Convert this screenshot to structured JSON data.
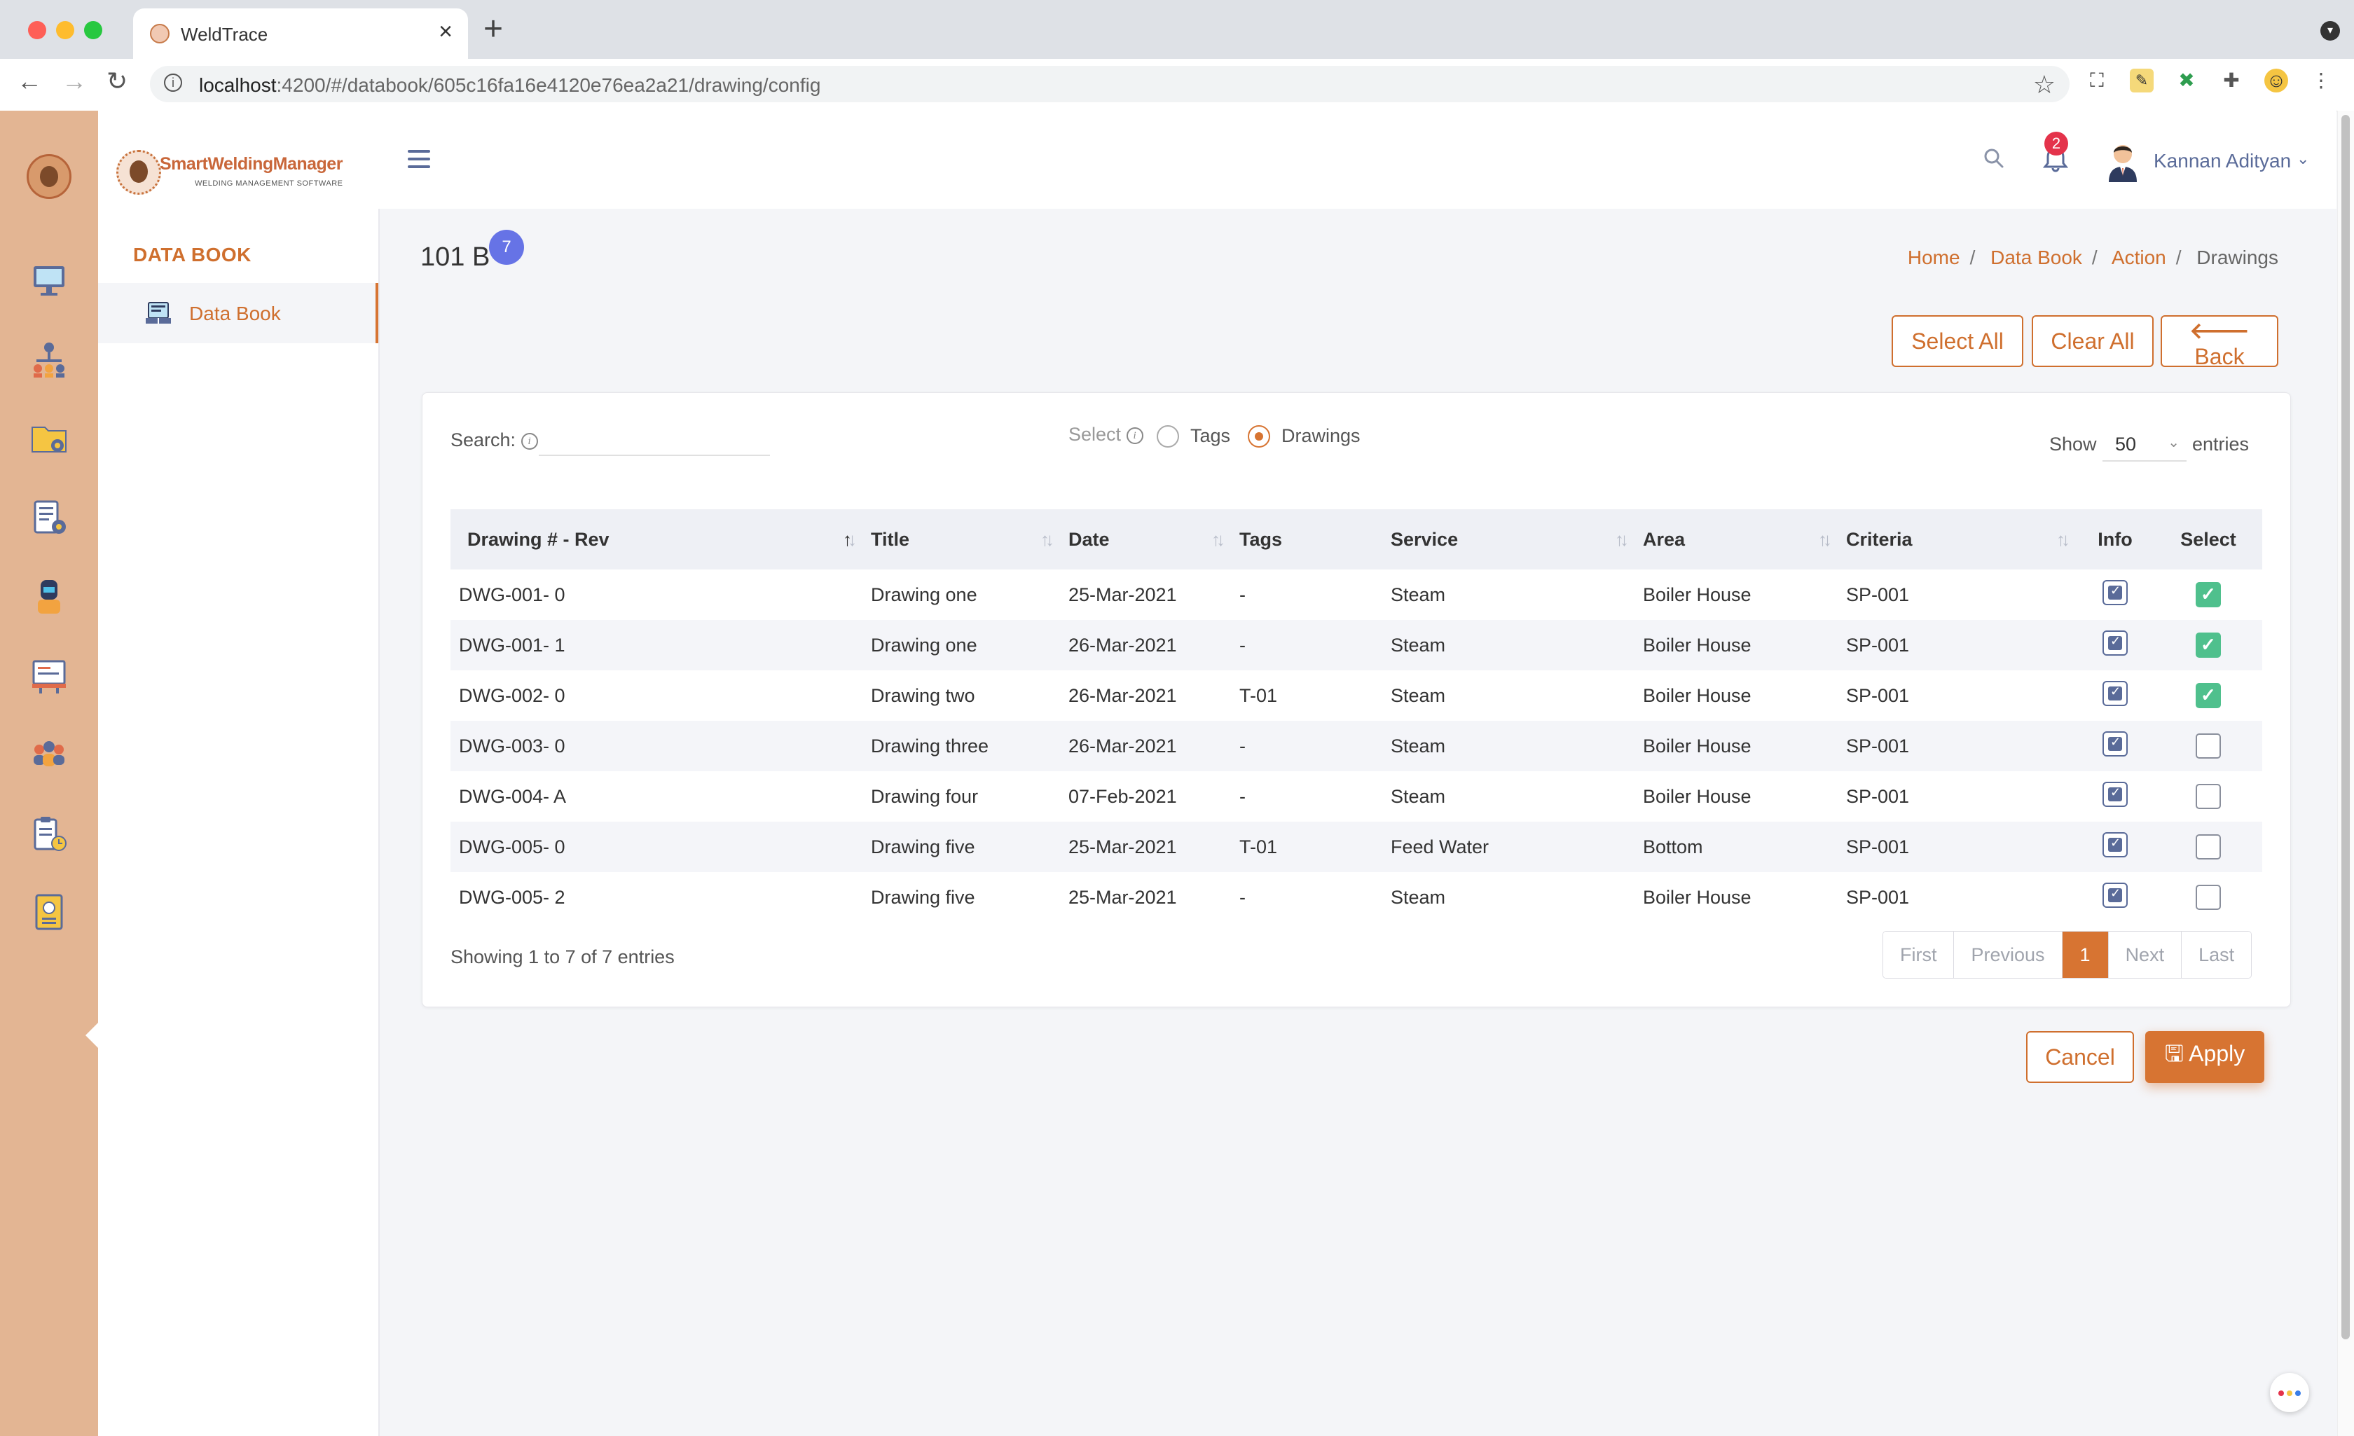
{
  "browser": {
    "tab_title": "WeldTrace",
    "url_host": "localhost",
    "url_path": ":4200/#/databook/605c16fa16e4120e76ea2a21/drawing/config"
  },
  "brand": {
    "name": "SmartWeldingManager",
    "tagline": "WELDING MANAGEMENT SOFTWARE",
    "accent": "#d77432"
  },
  "nav": {
    "section": "DATA BOOK",
    "items": [
      {
        "label": "Data Book"
      }
    ]
  },
  "header": {
    "notification_count": "2",
    "user_name": "Kannan Adityan"
  },
  "page": {
    "title": "101 B",
    "badge": "7",
    "breadcrumb": [
      "Home",
      "Data Book",
      "Action",
      "Drawings"
    ]
  },
  "actions": {
    "select_all": "Select All",
    "clear_all": "Clear All",
    "back": "Back",
    "cancel": "Cancel",
    "apply": "Apply"
  },
  "filter": {
    "search_label": "Search:",
    "search_value": "",
    "select_label": "Select",
    "options": [
      "Tags",
      "Drawings"
    ],
    "selected": "Drawings",
    "show_label": "Show",
    "show_value": "50",
    "entries_label": "entries"
  },
  "table": {
    "columns": [
      "Drawing # - Rev",
      "Title",
      "Date",
      "Tags",
      "Service",
      "Area",
      "Criteria",
      "Info",
      "Select"
    ],
    "rows": [
      {
        "drawing": "DWG-001- 0",
        "title": "Drawing one",
        "date": "25-Mar-2021",
        "tags": "-",
        "service": "Steam",
        "area": "Boiler House",
        "criteria": "SP-001",
        "selected": true
      },
      {
        "drawing": "DWG-001- 1",
        "title": "Drawing one",
        "date": "26-Mar-2021",
        "tags": "-",
        "service": "Steam",
        "area": "Boiler House",
        "criteria": "SP-001",
        "selected": true
      },
      {
        "drawing": "DWG-002- 0",
        "title": "Drawing two",
        "date": "26-Mar-2021",
        "tags": "T-01",
        "service": "Steam",
        "area": "Boiler House",
        "criteria": "SP-001",
        "selected": true
      },
      {
        "drawing": "DWG-003- 0",
        "title": "Drawing three",
        "date": "26-Mar-2021",
        "tags": "-",
        "service": "Steam",
        "area": "Boiler House",
        "criteria": "SP-001",
        "selected": false
      },
      {
        "drawing": "DWG-004- A",
        "title": "Drawing four",
        "date": "07-Feb-2021",
        "tags": "-",
        "service": "Steam",
        "area": "Boiler House",
        "criteria": "SP-001",
        "selected": false
      },
      {
        "drawing": "DWG-005- 0",
        "title": "Drawing five",
        "date": "25-Mar-2021",
        "tags": "T-01",
        "service": "Feed Water",
        "area": "Bottom",
        "criteria": "SP-001",
        "selected": false
      },
      {
        "drawing": "DWG-005- 2",
        "title": "Drawing five",
        "date": "25-Mar-2021",
        "tags": "-",
        "service": "Steam",
        "area": "Boiler House",
        "criteria": "SP-001",
        "selected": false
      }
    ]
  },
  "footer": {
    "showing": "Showing 1 to 7 of 7 entries",
    "pager": [
      "First",
      "Previous",
      "1",
      "Next",
      "Last"
    ]
  }
}
